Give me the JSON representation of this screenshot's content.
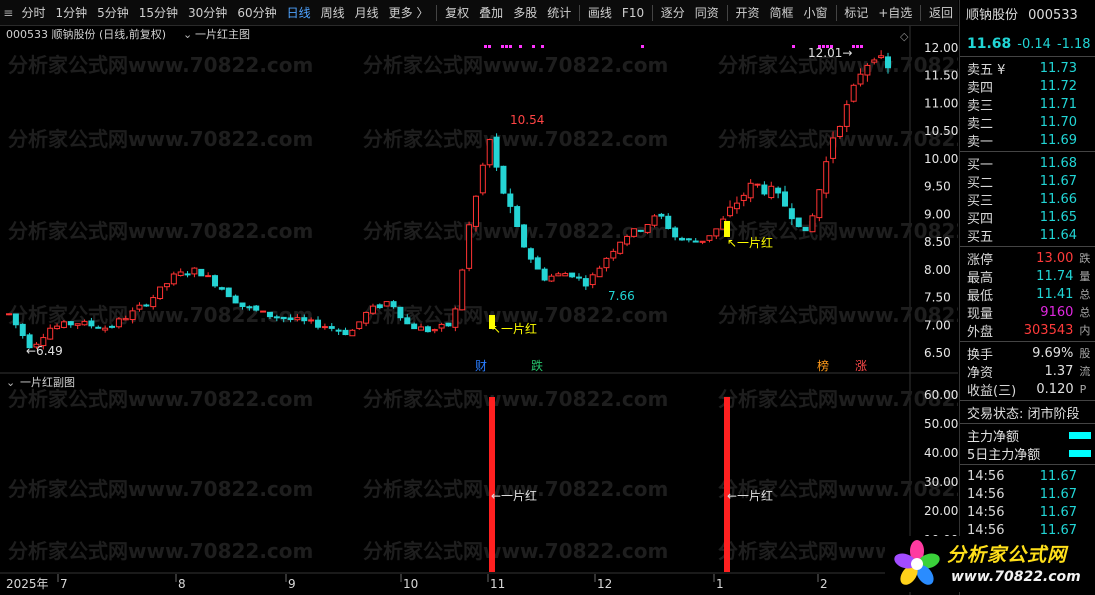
{
  "toolbar": {
    "items": [
      "分时",
      "1分钟",
      "5分钟",
      "15分钟",
      "30分钟",
      "60分钟",
      "日线",
      "周线",
      "月线",
      "更多 〉",
      "复权",
      "叠加",
      "多股",
      "统计",
      "画线",
      "F10",
      "逐分",
      "同资",
      "开资",
      "简框",
      "小窗",
      "标记",
      "+自选",
      "返回"
    ],
    "active": "日线"
  },
  "main_chart": {
    "title": "000533  顺钠股份 (日线,前复权)",
    "indicator": "一片红主图",
    "y_ticks": [
      "12.00",
      "11.50",
      "11.00",
      "10.50",
      "10.00",
      "9.50",
      "9.00",
      "8.50",
      "8.00",
      "7.50",
      "7.00",
      "6.50"
    ],
    "annotations": {
      "low_label": "6.49",
      "high_label": "10.54",
      "mid_low_label": "7.66",
      "recent_high_label": "12.01",
      "signal_1": "一片红",
      "signal_2": "一片红"
    },
    "event_tags": [
      "财",
      "跌",
      "榜",
      "涨"
    ],
    "watermark": "分析家公式网www.70822.com",
    "colors": {
      "up": "#ff3333",
      "down": "#25d4d4",
      "signal": "#ffff00",
      "magenta": "#ff33ff"
    }
  },
  "sub_chart": {
    "title": "一片红副图",
    "y_ticks": [
      "60.00",
      "50.00",
      "40.00",
      "30.00",
      "20.00",
      "10.00"
    ],
    "signal_label_1": "一片红",
    "signal_label_2": "一片红"
  },
  "time_axis": {
    "labels": [
      "2025年",
      "7",
      "8",
      "9",
      "10",
      "11",
      "12",
      "1",
      "2"
    ]
  },
  "right_panel": {
    "name": "顺钠股份",
    "code": "000533",
    "price": "11.68",
    "change": "-0.14",
    "change_pct": "-1.18",
    "asks": [
      {
        "label": "卖五 ¥",
        "value": "11.73"
      },
      {
        "label": "卖四",
        "value": "11.72"
      },
      {
        "label": "卖三",
        "value": "11.71"
      },
      {
        "label": "卖二",
        "value": "11.70"
      },
      {
        "label": "卖一",
        "value": "11.69"
      }
    ],
    "bids": [
      {
        "label": "买一",
        "value": "11.68"
      },
      {
        "label": "买二",
        "value": "11.67"
      },
      {
        "label": "买三",
        "value": "11.66"
      },
      {
        "label": "买四",
        "value": "11.65"
      },
      {
        "label": "买五",
        "value": "11.64"
      }
    ],
    "stats": [
      {
        "label": "涨停",
        "value": "13.00",
        "tail": "跌"
      },
      {
        "label": "最高",
        "value": "11.74",
        "tail": "量"
      },
      {
        "label": "最低",
        "value": "11.41",
        "tail": "总"
      },
      {
        "label": "现量",
        "value": "9160",
        "tail": "总"
      },
      {
        "label": "外盘",
        "value": "303543",
        "tail": "内"
      }
    ],
    "fundamentals": [
      {
        "label": "换手",
        "value": "9.69%",
        "tail": "股"
      },
      {
        "label": "净资",
        "value": "1.37",
        "tail": "流"
      },
      {
        "label": "收益(三)",
        "value": "0.120",
        "tail": "P"
      }
    ],
    "trade_status": "交易状态: 闭市阶段",
    "flows": [
      {
        "label": "主力净额"
      },
      {
        "label": "5日主力净额"
      }
    ],
    "ticks": [
      {
        "time": "14:56",
        "price": "11.67"
      },
      {
        "time": "14:56",
        "price": "11.67"
      },
      {
        "time": "14:56",
        "price": "11.67"
      },
      {
        "time": "14:56",
        "price": "11.67"
      }
    ]
  },
  "logo": {
    "title": "分析家公式网",
    "url": "www.70822.com"
  }
}
